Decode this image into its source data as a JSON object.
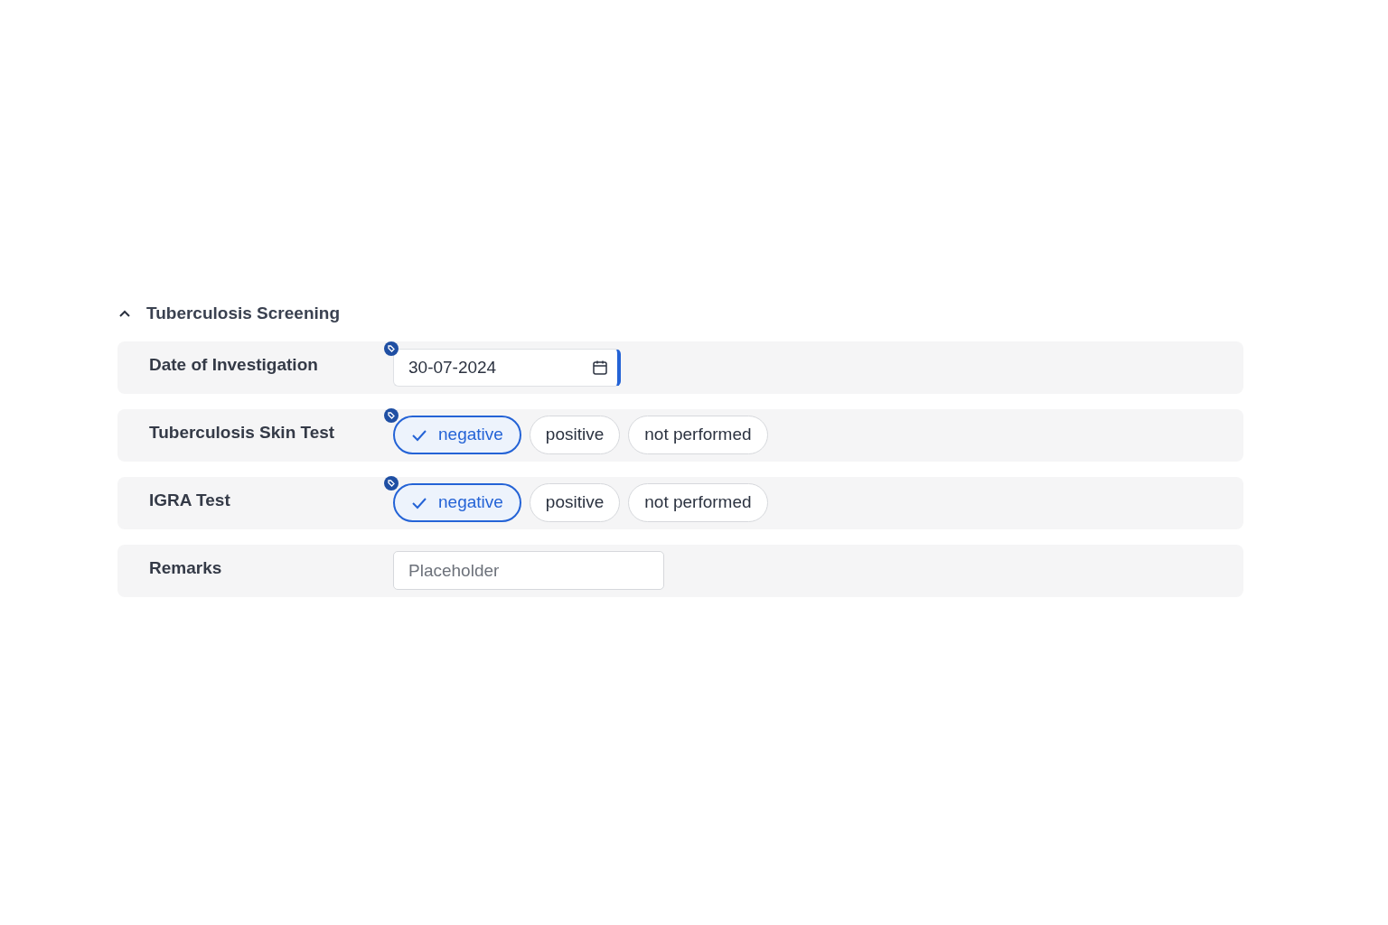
{
  "section": {
    "title": "Tuberculosis Screening",
    "expanded": true,
    "fields": [
      {
        "kind": "date",
        "label": "Date of Investigation",
        "tagged": true,
        "value": "30-07-2024"
      },
      {
        "kind": "choice",
        "label": "Tuberculosis Skin Test",
        "tagged": true,
        "options": [
          {
            "label": "negative",
            "selected": true
          },
          {
            "label": "positive",
            "selected": false
          },
          {
            "label": "not performed",
            "selected": false
          }
        ]
      },
      {
        "kind": "choice",
        "label": "IGRA Test",
        "tagged": true,
        "options": [
          {
            "label": "negative",
            "selected": true
          },
          {
            "label": "positive",
            "selected": false
          },
          {
            "label": "not performed",
            "selected": false
          }
        ]
      },
      {
        "kind": "text",
        "label": "Remarks",
        "tagged": false,
        "placeholder": "Placeholder"
      }
    ]
  }
}
